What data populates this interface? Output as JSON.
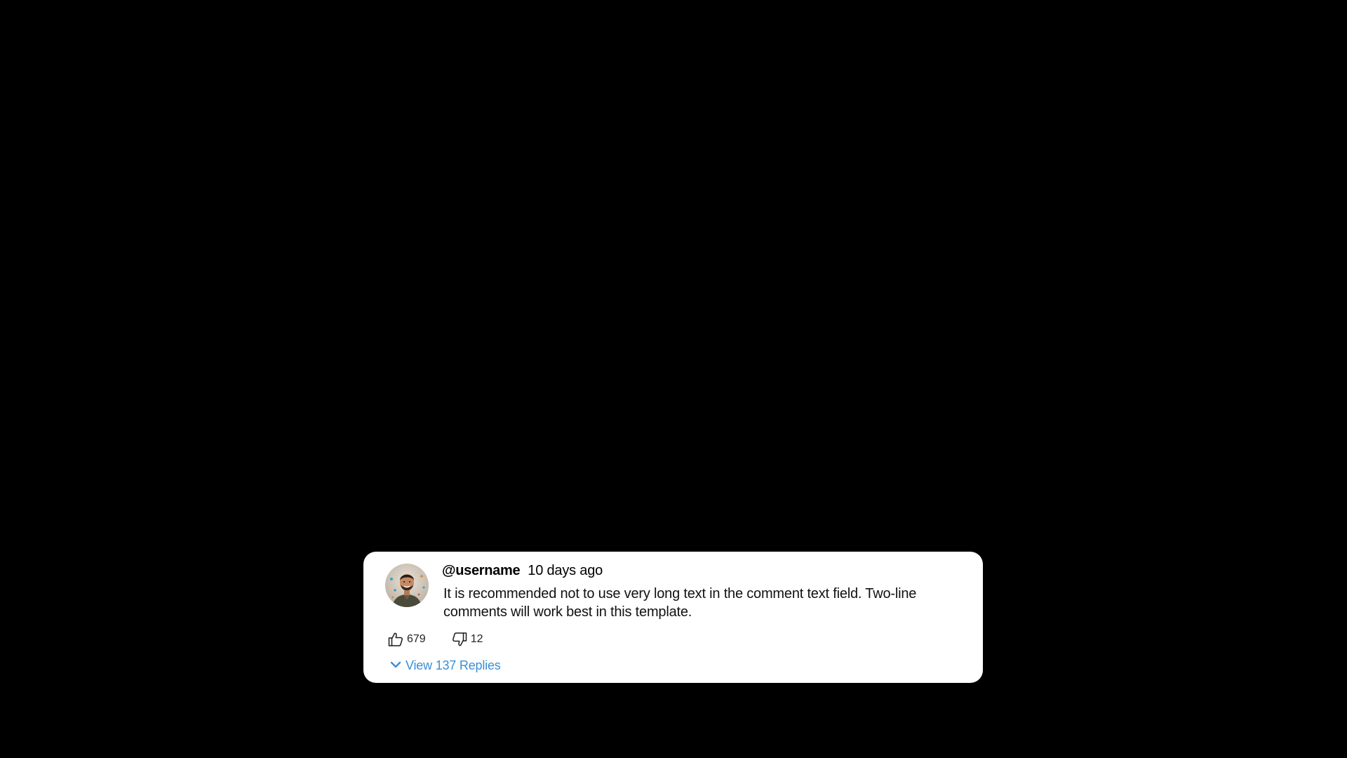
{
  "colors": {
    "background": "#000000",
    "card": "#ffffff",
    "link": "#3a8fd6"
  },
  "comment": {
    "avatar_icon": "user-avatar-photo",
    "username": "@username",
    "timestamp": "10 days ago",
    "text": "It is recommended not to use very long text in the comment text field. Two-line comments will work best in this template.",
    "likes": {
      "icon": "thumbs-up-icon",
      "count": "679"
    },
    "dislikes": {
      "icon": "thumbs-down-icon",
      "count": "12"
    },
    "replies": {
      "icon": "chevron-down-icon",
      "label": "View 137 Replies"
    }
  }
}
